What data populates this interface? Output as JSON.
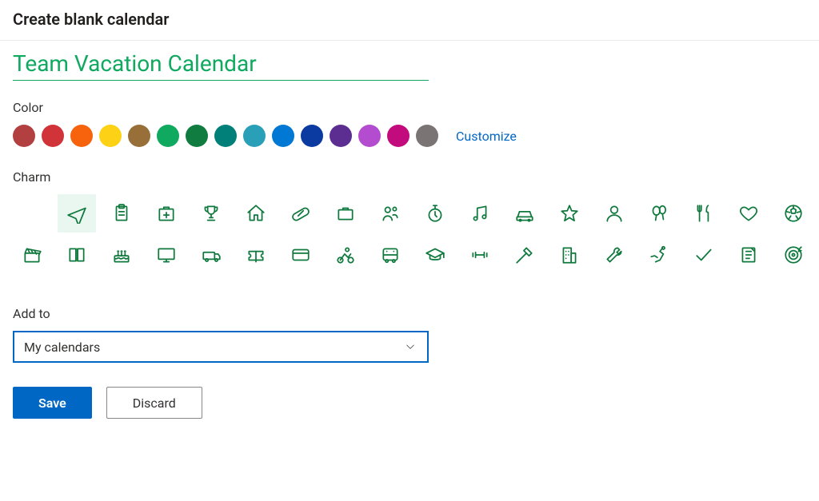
{
  "header": {
    "title": "Create blank calendar"
  },
  "name_field": {
    "value": "Team Vacation Calendar"
  },
  "sections": {
    "color_label": "Color",
    "charm_label": "Charm",
    "addto_label": "Add to"
  },
  "colors": [
    "#b34040",
    "#d13438",
    "#f7630c",
    "#fcd116",
    "#986f38",
    "#10a960",
    "#107c40",
    "#008078",
    "#2aa0b8",
    "#0078d4",
    "#0b3aa0",
    "#5c2e91",
    "#b44ccf",
    "#c20c7e",
    "#7a7574"
  ],
  "customize_label": "Customize",
  "charms_row1": [
    "none",
    "airplane",
    "clipboard",
    "firstaid",
    "trophy",
    "home",
    "pill",
    "briefcase",
    "people",
    "stopwatch",
    "music",
    "car",
    "star",
    "person",
    "balloons",
    "utensils",
    "heart",
    "soccer"
  ],
  "charms_row2": [
    "clapper",
    "book",
    "cake",
    "monitor",
    "van",
    "ticket",
    "creditcard",
    "cycling",
    "bus",
    "graduation",
    "dumbbell",
    "tools",
    "building",
    "wrench",
    "running",
    "checkmark",
    "notebook",
    "target"
  ],
  "selected_charm": "airplane",
  "dropdown": {
    "value": "My calendars"
  },
  "actions": {
    "save": "Save",
    "discard": "Discard"
  }
}
